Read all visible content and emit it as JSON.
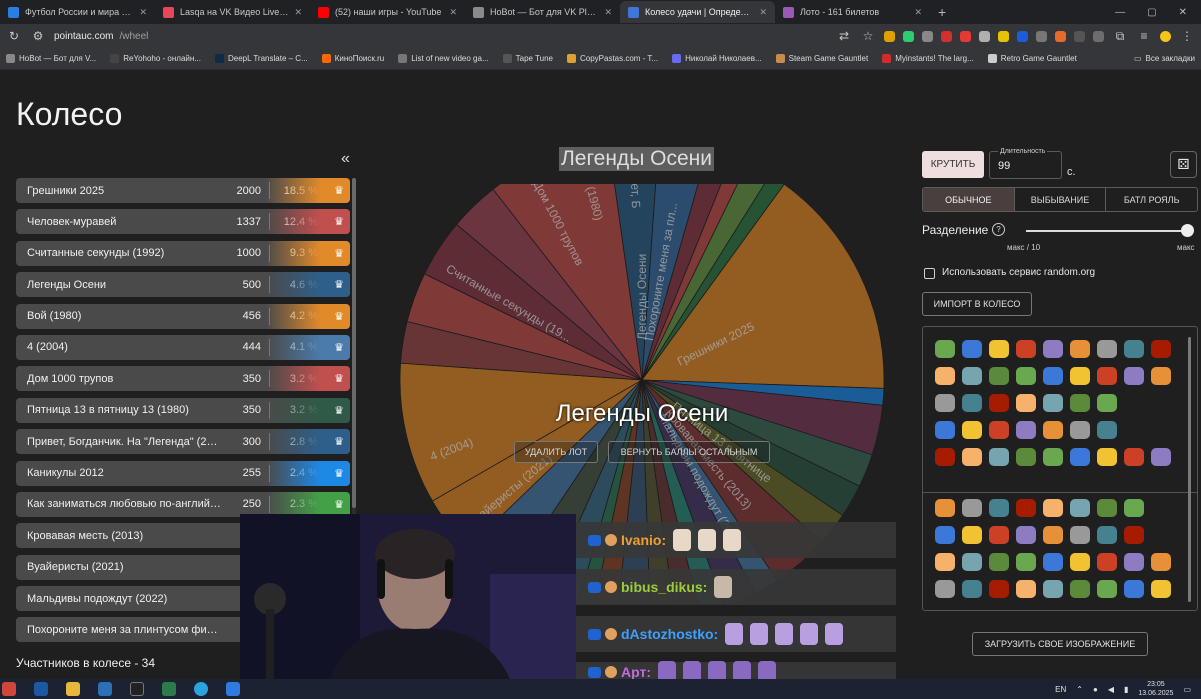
{
  "browser": {
    "tabs": [
      {
        "title": "Футбол России и мира 2025 - ",
        "color": "#2a7de1",
        "active": false
      },
      {
        "title": "Lasqa на VK Видео Live – смот",
        "color": "#e8465a",
        "active": false
      },
      {
        "title": "(52) наши игры - YouTube",
        "color": "#ff0000",
        "active": false
      },
      {
        "title": "HoBot — Бот для VK Play Live",
        "color": "#8a8a8a",
        "active": false
      },
      {
        "title": "Колесо удачи | Определите по",
        "color": "#3f76d8",
        "active": true
      },
      {
        "title": "Лото - 161 билетов",
        "color": "#9b59b6",
        "active": false
      }
    ],
    "newtab": "+",
    "url": "pointauc.com",
    "url_path": "/wheel",
    "bookmarks": [
      {
        "label": "HoBot — Бот для V...",
        "color": "#888"
      },
      {
        "label": "ReYohoho - онлайн...",
        "color": "#444"
      },
      {
        "label": "DeepL Translate – C...",
        "color": "#0f2b46"
      },
      {
        "label": "КиноПоиск.ru",
        "color": "#ff6600"
      },
      {
        "label": "List of new video ga...",
        "color": "#777"
      },
      {
        "label": "Tape Tune",
        "color": "#555"
      },
      {
        "label": "CopyPastas.com - T...",
        "color": "#e0a030"
      },
      {
        "label": "Николай Николаев...",
        "color": "#6a6af0"
      },
      {
        "label": "Steam Game Gauntlet",
        "color": "#c98b4b"
      },
      {
        "label": "Myinstants! The larg...",
        "color": "#d12b2b"
      },
      {
        "label": "Retro Game Gauntlet",
        "color": "#ccc"
      }
    ],
    "all_bookmarks": "Все закладки"
  },
  "page": {
    "title": "Колесо",
    "collapse": "«",
    "lots": [
      {
        "name": "Грешники 2025",
        "amount": "2000",
        "percent": "18.5 %",
        "color": "#e08a2a"
      },
      {
        "name": "Человек-муравей",
        "amount": "1337",
        "percent": "12.4 %",
        "color": "#c0504d"
      },
      {
        "name": "Считанные секунды (1992)",
        "amount": "1000",
        "percent": "9.3 %",
        "color": "#e08a2a"
      },
      {
        "name": "Легенды Осени",
        "amount": "500",
        "percent": "4.6 %",
        "color": "#2e5f8a"
      },
      {
        "name": "Вой (1980)",
        "amount": "456",
        "percent": "4.2 %",
        "color": "#e08a2a"
      },
      {
        "name": "4 (2004)",
        "amount": "444",
        "percent": "4.1 %",
        "color": "#4a7bab"
      },
      {
        "name": "Дом 1000 трупов",
        "amount": "350",
        "percent": "3.2 %",
        "color": "#c0504d"
      },
      {
        "name": "Пятница 13 в пятницу 13 (1980)",
        "amount": "350",
        "percent": "3.2 %",
        "color": "#2f5a47"
      },
      {
        "name": "Привет, Богданчик. На \"Легенда\" (2015)",
        "amount": "300",
        "percent": "2.8 %",
        "color": "#2e5f8a"
      },
      {
        "name": "Каникулы 2012",
        "amount": "255",
        "percent": "2.4 %",
        "color": "#1e88e5"
      },
      {
        "name": "Как заниматься любовью по-английск...",
        "amount": "250",
        "percent": "2.3 %",
        "color": "#43a047"
      },
      {
        "name": "Кровавая месть (2013)",
        "amount": "2",
        "percent": "",
        "color": "#4a4a4a"
      },
      {
        "name": "Вуайеристы (2021)",
        "amount": "2",
        "percent": "",
        "color": "#4a4a4a"
      },
      {
        "name": "Мальдивы подождут (2022)",
        "amount": "2",
        "percent": "",
        "color": "#4a4a4a"
      },
      {
        "name": "Похороните меня за плинтусом филь...",
        "amount": "2",
        "percent": "",
        "color": "#4a4a4a"
      }
    ],
    "participants": "Участников в колесе - 34"
  },
  "wheel": {
    "title": "Легенды Осени",
    "winner": "Легенды Осени",
    "delete_lot": "УДАЛИТЬ ЛОТ",
    "return_points": "ВЕРНУТЬ БАЛЛЫ ОСТАЛЬНЫМ",
    "slice_labels": [
      "Грешники 2025",
      "Считанные секунды (19...",
      "4 (2004)",
      "Вуайеристы (2021)",
      "Дом 1000 трупов",
      "Вой (1980)",
      "Привет, Б",
      "Легенды Осени",
      "Похороните меня за пл...",
      "Кровавая месть (2013)",
      "Пятница 13 в пятнице",
      "Мальдивы подождут (20..."
    ]
  },
  "controls": {
    "spin": "КРУТИТЬ",
    "duration_label": "Длительность",
    "duration_value": "99",
    "duration_unit": "с.",
    "dice": "⚄",
    "modes": [
      {
        "label": "ОБЫЧНОЕ",
        "active": true
      },
      {
        "label": "ВЫБЫВАНИЕ",
        "active": false
      },
      {
        "label": "БАТЛ РОЯЛЬ",
        "active": false
      }
    ],
    "split_label": "Разделение",
    "help": "?",
    "split_min": "макс / 10",
    "split_max": "макс",
    "split_level": 1.0,
    "random_org": "Использовать сервис random.org",
    "import": "ИМПОРТ В КОЛЕСО",
    "upload": "ЗАГРУЗИТЬ СВОЕ ИЗОБРАЖЕНИЕ"
  },
  "chat": {
    "messages": [
      {
        "user": "Ivanio:",
        "color": "#f0a030"
      },
      {
        "user": "bibus_dikus:",
        "color": "#9ccc3c"
      },
      {
        "user": "dAstozhostko:",
        "color": "#3da0ff"
      },
      {
        "user": "Арт:",
        "color": "#c06be0"
      }
    ]
  },
  "taskbar": {
    "lang": "EN",
    "time": "23:05",
    "date": "13.06.2025"
  }
}
